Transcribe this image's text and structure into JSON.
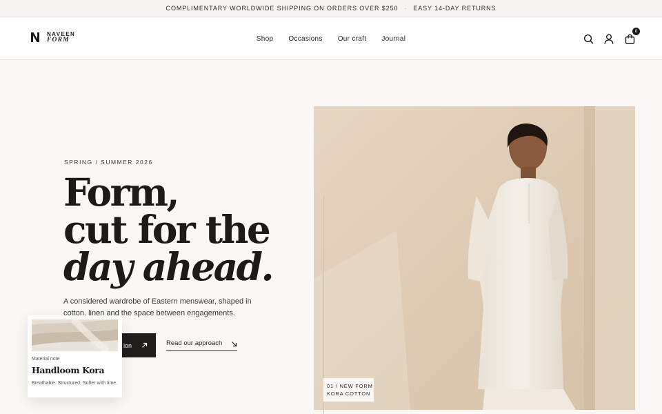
{
  "announcement": {
    "shipping": "COMPLIMENTARY WORLDWIDE SHIPPING ON ORDERS OVER $250",
    "separator": "·",
    "returns": "EASY 14-DAY RETURNS"
  },
  "brand": {
    "line1": "NAVEEN",
    "line2": "FORM",
    "mark_icon": "n-monogram-icon"
  },
  "nav": {
    "items": [
      {
        "label": "Shop"
      },
      {
        "label": "Occasions"
      },
      {
        "label": "Our craft"
      },
      {
        "label": "Journal"
      }
    ]
  },
  "header_icons": {
    "search": "search-icon",
    "account": "user-icon",
    "cart": "bag-icon",
    "cart_count": "0"
  },
  "hero": {
    "eyebrow": "SPRING / SUMMER 2026",
    "headline_line1": "Form,",
    "headline_line2": "cut for the",
    "headline_line3": "day ahead.",
    "subcopy": "A considered wardrobe of Eastern menswear, shaped in cotton, linen and the space between engagements.",
    "primary_cta": "ion",
    "secondary_cta": "Read our approach"
  },
  "material_card": {
    "label": "Material note",
    "title": "Handloom Kora",
    "description": "Breathable. Structured. Softer with time."
  },
  "hero_caption": {
    "line1": "01 / NEW FORM",
    "line2": "KORA COTTON"
  },
  "colors": {
    "page_bg": "#faf8f4",
    "ink": "#1c1b19",
    "image_wall": "#e3d2bd"
  }
}
